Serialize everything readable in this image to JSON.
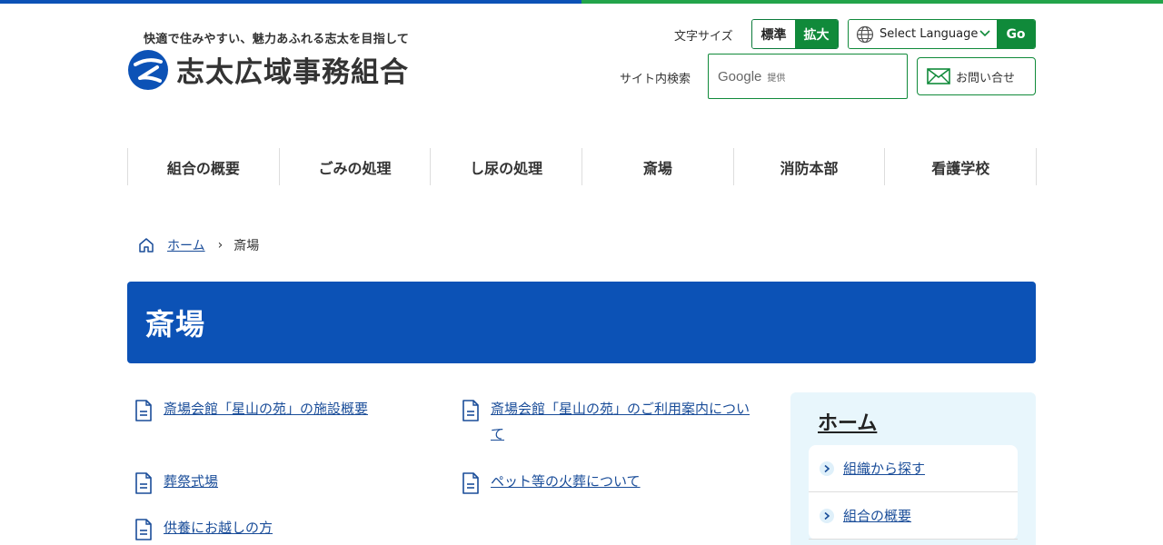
{
  "header": {
    "tagline": "快適で住みやすい、魅力あふれる志太を目指して",
    "site_name": "志太広域事務組合",
    "font_size": {
      "label": "文字サイズ",
      "standard": "標準",
      "large": "拡大"
    },
    "language": {
      "selected": "Select Language",
      "go": "Go"
    },
    "search": {
      "label": "サイト内検索",
      "provider_brand": "Google",
      "provider_suffix": "提供"
    },
    "contact": "お問い合せ"
  },
  "global_nav": [
    {
      "label": "組合の概要"
    },
    {
      "label": "ごみの処理"
    },
    {
      "label": "し尿の処理"
    },
    {
      "label": "斎場"
    },
    {
      "label": "消防本部"
    },
    {
      "label": "看護学校"
    }
  ],
  "breadcrumb": {
    "home": "ホーム",
    "separator": "›",
    "current": "斎場"
  },
  "page_title": "斎場",
  "links": [
    {
      "label": "斎場会館「星山の苑」の施設概要"
    },
    {
      "label": "斎場会館「星山の苑」のご利用案内について"
    },
    {
      "label": "葬祭式場"
    },
    {
      "label": "ペット等の火葬について"
    },
    {
      "label": "供養にお越しの方"
    }
  ],
  "sidebar": {
    "heading": "ホーム",
    "items": [
      {
        "label": "組織から探す"
      },
      {
        "label": "組合の概要"
      }
    ]
  },
  "colors": {
    "brand_blue": "#0c52b6",
    "brand_green": "#108a3a",
    "link": "#1a4d99",
    "sidebar_bg": "#e8f6fc"
  },
  "icons": [
    "logo-mark-icon",
    "globe-icon",
    "chevron-down-icon",
    "mail-icon",
    "home-icon",
    "document-icon",
    "chevron-right-icon"
  ]
}
